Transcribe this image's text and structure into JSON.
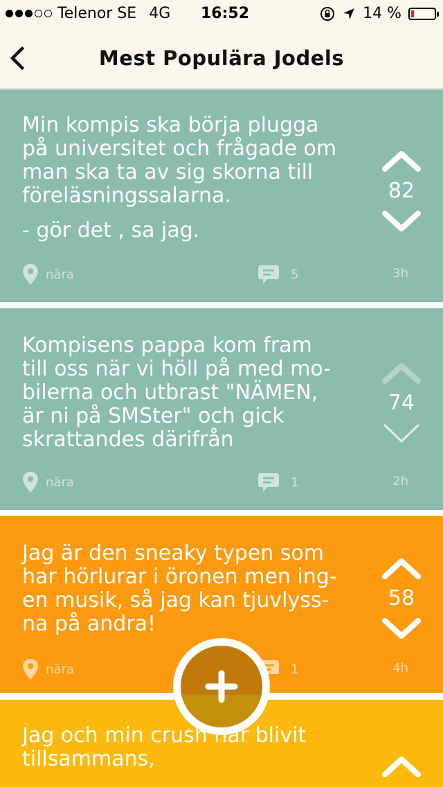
{
  "status_bar": {
    "signal_bars_filled": 3,
    "signal_bars_total": 5,
    "carrier": "Telenor SE",
    "network": "4G",
    "time": "16:52",
    "battery_percent": "14 %",
    "battery_level": 0.14,
    "icons": [
      "orientation-lock-icon",
      "location-arrow-icon",
      "battery-icon"
    ]
  },
  "nav": {
    "back_icon": "chevron-left-icon",
    "title": "Mest Populära Jodels"
  },
  "posts": [
    {
      "text": "Min kompis ska börja plugga\npå universitet och frågade om\nman ska ta av sig skorna till\nföreläsningssalarna.",
      "text2": "- gör det , sa jag.",
      "votes": "82",
      "location": "nära",
      "comments": "5",
      "age": "3h",
      "color": "#8bbcae",
      "voted": false
    },
    {
      "text": "Kompisens pappa kom fram\ntill oss när vi höll på med mo-\nbilerna och utbrast \"NÄMEN,\när ni på SMSter\" och gick\nskrattandes därifrån",
      "text2": "",
      "votes": "74",
      "location": "nära",
      "comments": "1",
      "age": "2h",
      "color": "#8bbcae",
      "voted": true
    },
    {
      "text": "Jag är den sneaky typen som\nhar hörlurar i öronen men ing-\nen musik, så jag kan tjuvlyss-\nna på andra!",
      "text2": "",
      "votes": "58",
      "location": "nära",
      "comments": "1",
      "age": "4h",
      "color": "#fe9a0f",
      "voted": false
    },
    {
      "text": "Jag och min crush har blivit\ntillsammans,",
      "text2": "",
      "votes": "",
      "location": "",
      "comments": "",
      "age": "",
      "color": "#fdb90d",
      "voted": false
    }
  ],
  "fab": {
    "icon": "plus-icon"
  },
  "colors": {
    "header_bg": "#fbf7ea",
    "teal": "#8bbcae",
    "orange": "#fe9a0f",
    "yellow": "#fdb90d",
    "fab": "#c17a0a"
  }
}
